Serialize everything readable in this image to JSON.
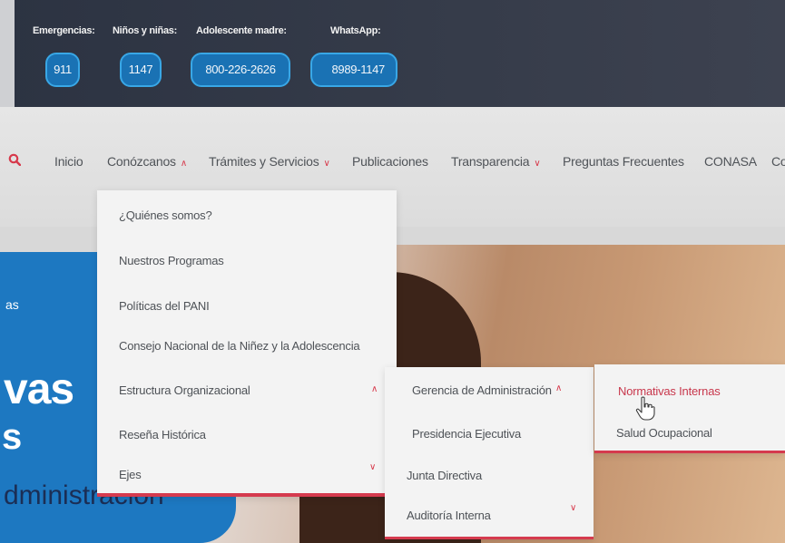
{
  "contacts": [
    {
      "label": "Emergencias:",
      "number": "911"
    },
    {
      "label": "Niños y niñas:",
      "number": "1147"
    },
    {
      "label": "Adolescente madre:",
      "number": "800-226-2626"
    },
    {
      "label": "WhatsApp:",
      "number": "8989-1147"
    }
  ],
  "nav": {
    "items": [
      {
        "label": "Inicio"
      },
      {
        "label": "Conózcanos",
        "chevron": "^"
      },
      {
        "label": "Trámites y Servicios",
        "chevron": "v"
      },
      {
        "label": "Publicaciones"
      },
      {
        "label": "Transparencia",
        "chevron": "v"
      },
      {
        "label": "Preguntas Frecuentes"
      },
      {
        "label": "CONASA"
      },
      {
        "label": "Co"
      }
    ]
  },
  "menu1": {
    "items": [
      {
        "label": "¿Quiénes somos?"
      },
      {
        "label": "Nuestros Programas"
      },
      {
        "label": "Políticas del PANI"
      },
      {
        "label": "Consejo Nacional de la Niñez y la Adolescencia"
      },
      {
        "label": "Estructura Organizacional",
        "chevron": "^"
      },
      {
        "label": "Reseña Histórica"
      },
      {
        "label": "Ejes",
        "chevron": "v"
      }
    ]
  },
  "menu2": {
    "items": [
      {
        "label": "Gerencia de Administración",
        "chevron": "^"
      },
      {
        "label": "Presidencia Ejecutiva"
      },
      {
        "label": "Junta Directiva"
      },
      {
        "label": "Auditoría Interna",
        "chevron": "v"
      }
    ]
  },
  "menu3": {
    "items": [
      {
        "label": "Normativas Internas"
      },
      {
        "label": "Salud Ocupacional"
      }
    ]
  },
  "hero": {
    "small": "as",
    "big": "vas",
    "big2": "s",
    "sub": "dministración"
  },
  "colors": {
    "topbar": "#2c3342",
    "pill": "#1a72b4",
    "accent": "#d7394b",
    "hero_blue": "#1d78c1"
  }
}
